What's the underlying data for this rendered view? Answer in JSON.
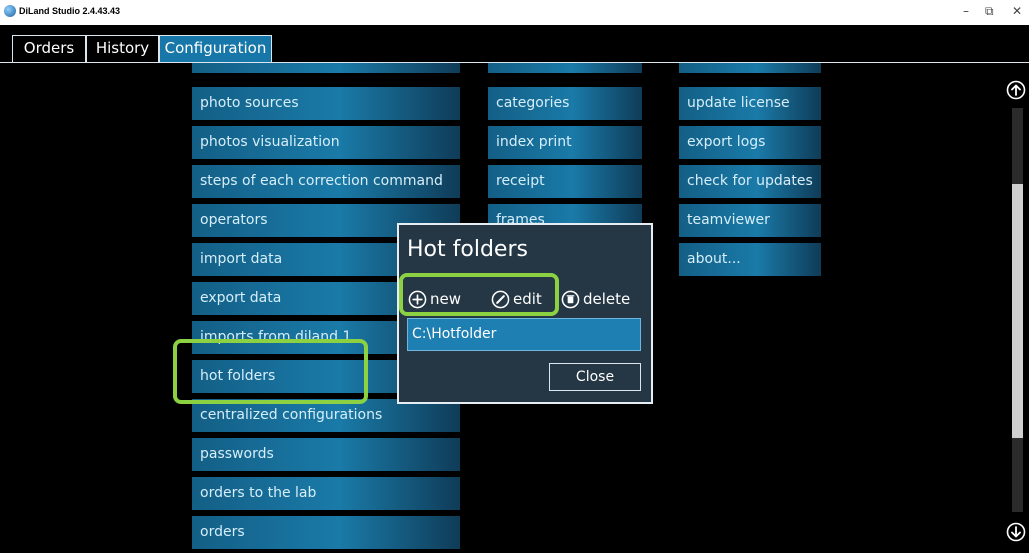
{
  "window": {
    "title": "DiLand Studio 2.4.43.43",
    "minimize": "–",
    "restore": "⧉",
    "close": "✕"
  },
  "tabs": [
    {
      "label": "Orders"
    },
    {
      "label": "History"
    },
    {
      "label": "Configuration"
    }
  ],
  "menu": {
    "column1": [
      "photo sources",
      "photos visualization",
      "steps of each correction command",
      "operators",
      "import data",
      "export data",
      "imports from diland 1",
      "hot folders",
      "centralized configurations",
      "passwords",
      "orders to the lab",
      "orders"
    ],
    "column2": [
      "categories",
      "index print",
      "receipt",
      "frames"
    ],
    "column3": [
      "update license",
      "export logs",
      "check for updates",
      "teamviewer",
      "about..."
    ]
  },
  "dialog": {
    "title": "Hot folders",
    "new_label": "new",
    "edit_label": "edit",
    "delete_label": "delete",
    "items": [
      "C:\\Hotfolder"
    ],
    "close_label": "Close"
  },
  "colors": {
    "accent": "#1677a8",
    "highlight": "#8bd142",
    "dialog_bg": "#253744"
  }
}
